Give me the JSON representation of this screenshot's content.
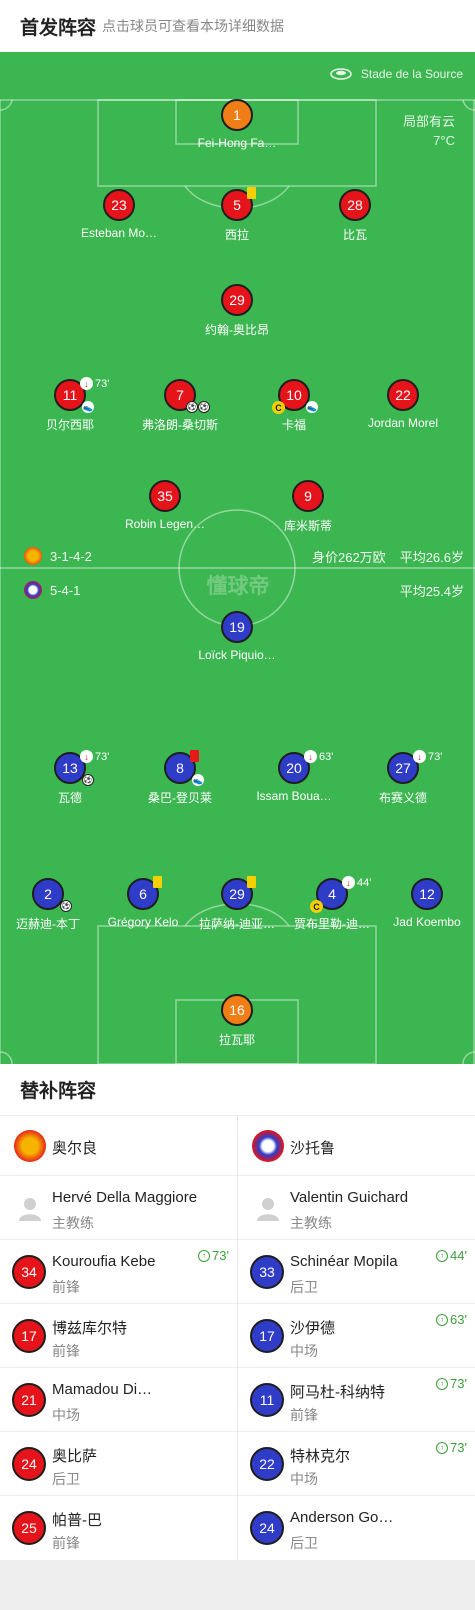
{
  "header": {
    "title": "首发阵容",
    "hint": "点击球员可查看本场详细数据"
  },
  "pitch": {
    "venue": "Stade de la Source",
    "weather": "局部有云",
    "temperature": "7°C",
    "watermark": "懂球帝"
  },
  "home_team": {
    "formation": "3-1-4-2",
    "market_value": "身价262万欧",
    "avg_age": "平均26.6岁"
  },
  "away_team": {
    "formation": "5-4-1",
    "avg_age": "平均25.4岁"
  },
  "home_players": [
    {
      "num": "1",
      "name": "Fei-Hong Fa…"
    },
    {
      "num": "23",
      "name": "Esteban Mo…"
    },
    {
      "num": "5",
      "name": "西拉"
    },
    {
      "num": "28",
      "name": "比瓦"
    },
    {
      "num": "29",
      "name": "约翰-奥比昂"
    },
    {
      "num": "11",
      "name": "贝尔西耶",
      "sub_min": "73'"
    },
    {
      "num": "7",
      "name": "弗洛朗-桑切斯"
    },
    {
      "num": "10",
      "name": "卡福"
    },
    {
      "num": "22",
      "name": "Jordan Morel"
    },
    {
      "num": "35",
      "name": "Robin Legen…"
    },
    {
      "num": "9",
      "name": "库米斯蒂"
    }
  ],
  "away_players": [
    {
      "num": "19",
      "name": "Loïck Piquio…"
    },
    {
      "num": "13",
      "name": "瓦德",
      "sub_min": "73'"
    },
    {
      "num": "8",
      "name": "桑巴-登贝莱"
    },
    {
      "num": "20",
      "name": "Issam Boua…",
      "sub_min": "63'"
    },
    {
      "num": "27",
      "name": "布赛义德",
      "sub_min": "73'"
    },
    {
      "num": "2",
      "name": "迈赫迪-本丁"
    },
    {
      "num": "6",
      "name": "Grégory Kelo"
    },
    {
      "num": "29",
      "name": "拉萨纳-迪亚…"
    },
    {
      "num": "4",
      "name": "贾布里勒-迪…",
      "sub_min": "44'"
    },
    {
      "num": "12",
      "name": "Jad Koembo"
    },
    {
      "num": "16",
      "name": "拉瓦耶"
    }
  ],
  "icons": {
    "captain": "C",
    "goal": "⚽",
    "assist": "👟",
    "sub_out": "↓",
    "sub_in": "↑"
  },
  "subs": {
    "title": "替补阵容",
    "home": {
      "club": "奥尔良",
      "coach": {
        "name": "Hervé Della Maggiore",
        "role": "主教练"
      },
      "players": [
        {
          "num": "34",
          "name": "Kouroufia Kebe",
          "pos": "前锋",
          "in": "73'"
        },
        {
          "num": "17",
          "name": "博兹库尔特",
          "pos": "前锋"
        },
        {
          "num": "21",
          "name": "Mamadou Di…",
          "pos": "中场"
        },
        {
          "num": "24",
          "name": "奥比萨",
          "pos": "后卫"
        },
        {
          "num": "25",
          "name": "帕普-巴",
          "pos": "前锋"
        }
      ]
    },
    "away": {
      "club": "沙托鲁",
      "coach": {
        "name": "Valentin Guichard",
        "role": "主教练"
      },
      "players": [
        {
          "num": "33",
          "name": "Schinéar Mopila",
          "pos": "后卫",
          "in": "44'"
        },
        {
          "num": "17",
          "name": "沙伊德",
          "pos": "中场",
          "in": "63'"
        },
        {
          "num": "11",
          "name": "阿马杜-科纳特",
          "pos": "前锋",
          "in": "73'"
        },
        {
          "num": "22",
          "name": "特林克尔",
          "pos": "中场",
          "in": "73'"
        },
        {
          "num": "24",
          "name": "Anderson Go…",
          "pos": "后卫"
        }
      ]
    }
  },
  "colors": {
    "pitch": "#3cb650",
    "home": "#e5141b",
    "away": "#2f3cc8",
    "goalkeeper": "#f07d15",
    "yellow_card": "#f5d000",
    "red_card": "#e61919",
    "sub_in": "#3ca03c"
  }
}
